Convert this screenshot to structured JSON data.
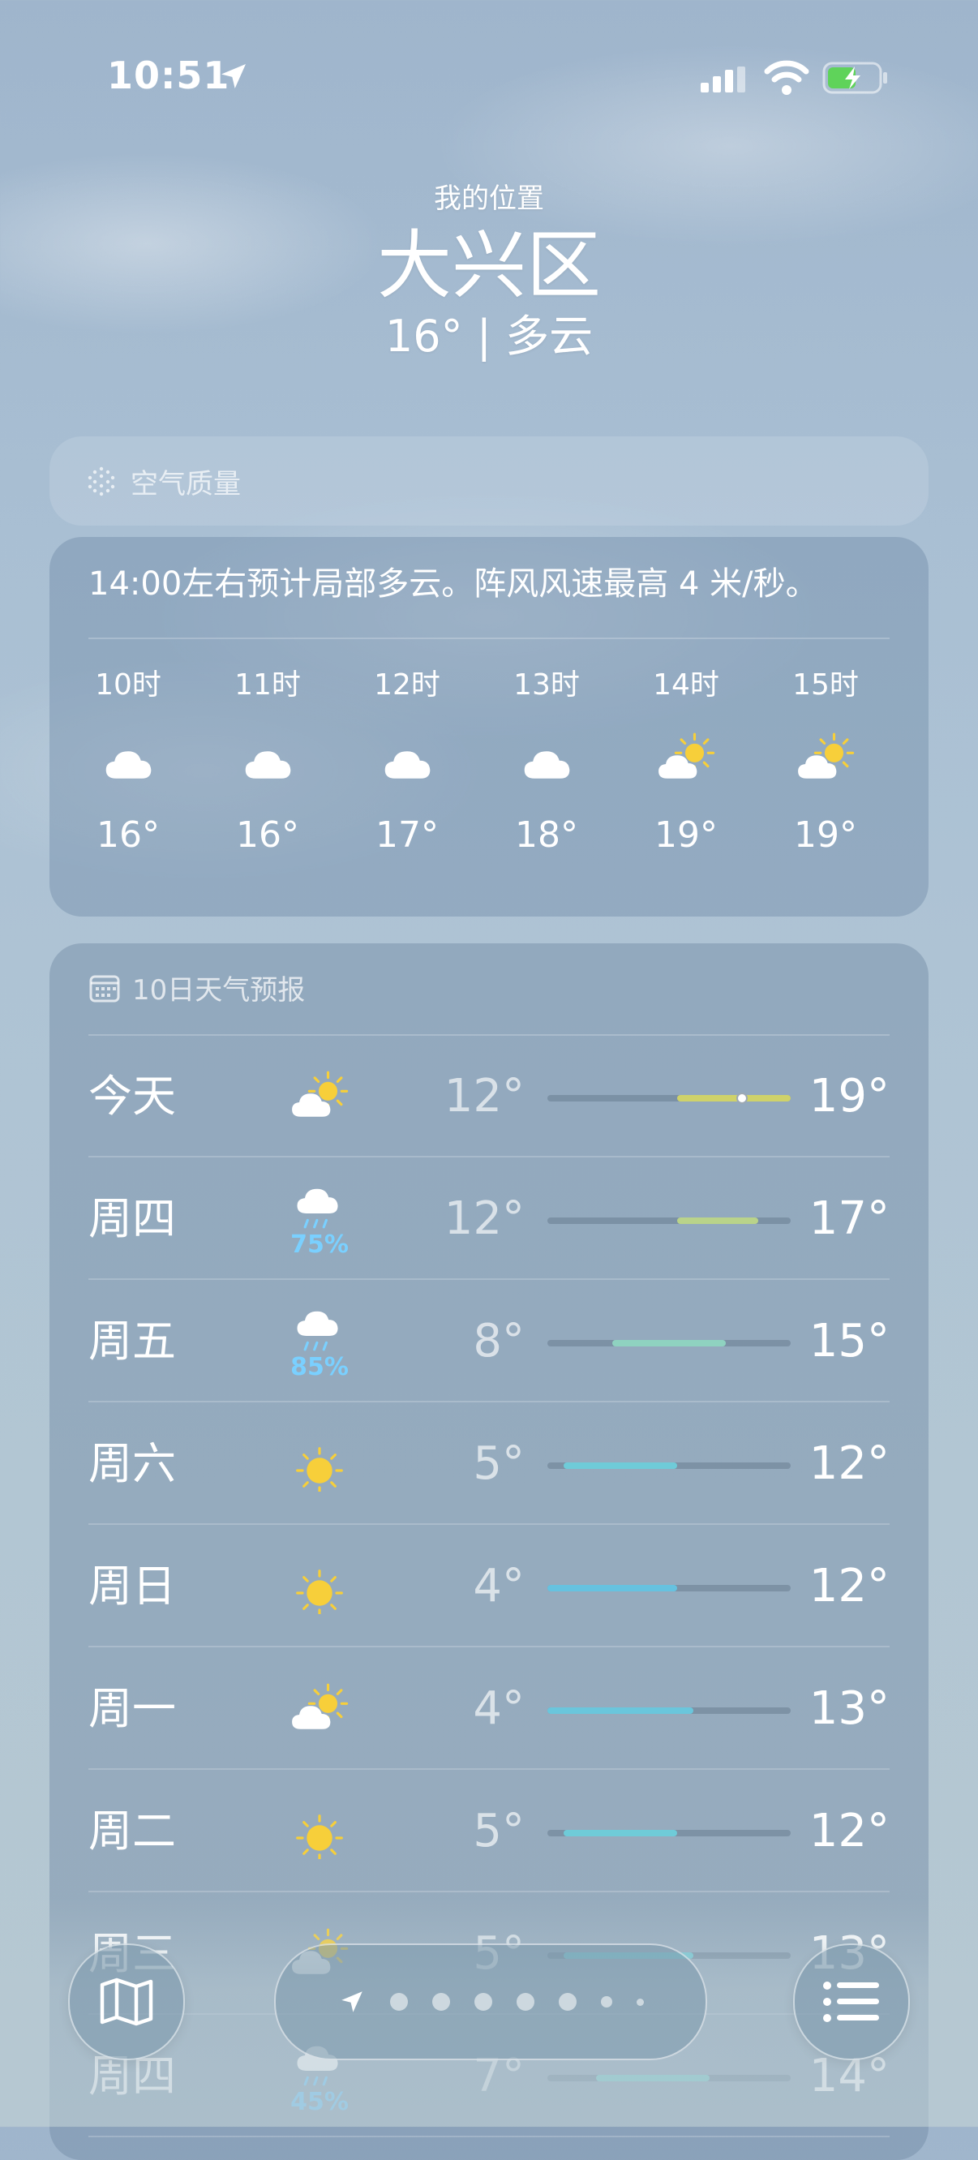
{
  "status_bar": {
    "time": "10:51"
  },
  "header": {
    "location_label": "我的位置",
    "city": "大兴区",
    "condition": "16° | 多云"
  },
  "air_quality": {
    "label": "空气质量",
    "icon": "air-quality-icon"
  },
  "hourly": {
    "description": "14:00左右预计局部多云。阵风风速最高 4 米/秒。",
    "hours": [
      {
        "time": "10时",
        "icon": "cloud",
        "temp": "16°"
      },
      {
        "time": "11时",
        "icon": "cloud",
        "temp": "16°"
      },
      {
        "time": "12时",
        "icon": "cloud",
        "temp": "17°"
      },
      {
        "time": "13时",
        "icon": "cloud",
        "temp": "18°"
      },
      {
        "time": "14时",
        "icon": "partly-cloudy",
        "temp": "19°"
      },
      {
        "time": "15时",
        "icon": "partly-cloudy",
        "temp": "19°"
      }
    ]
  },
  "daily": {
    "title": "10日天气预报",
    "range_min": 4,
    "range_max": 19,
    "days": [
      {
        "name": "今天",
        "icon": "partly-cloudy",
        "pop": "",
        "low": "12°",
        "high": "19°",
        "lo": 12,
        "hi": 19,
        "color": "#cfd26a",
        "current": 16
      },
      {
        "name": "周四",
        "icon": "rain",
        "pop": "75%",
        "low": "12°",
        "high": "17°",
        "lo": 12,
        "hi": 17,
        "color": "#b9d38a"
      },
      {
        "name": "周五",
        "icon": "rain",
        "pop": "85%",
        "low": "8°",
        "high": "15°",
        "lo": 8,
        "hi": 15,
        "color": "#8fd2c0"
      },
      {
        "name": "周六",
        "icon": "sun",
        "pop": "",
        "low": "5°",
        "high": "12°",
        "lo": 5,
        "hi": 12,
        "color": "#6fcbd8"
      },
      {
        "name": "周日",
        "icon": "sun",
        "pop": "",
        "low": "4°",
        "high": "12°",
        "lo": 4,
        "hi": 12,
        "color": "#66c2e0"
      },
      {
        "name": "周一",
        "icon": "partly-cloudy",
        "pop": "",
        "low": "4°",
        "high": "13°",
        "lo": 4,
        "hi": 13,
        "color": "#6ac6dc"
      },
      {
        "name": "周二",
        "icon": "sun",
        "pop": "",
        "low": "5°",
        "high": "12°",
        "lo": 5,
        "hi": 12,
        "color": "#6fcbd8"
      },
      {
        "name": "周三",
        "icon": "partly-cloudy",
        "pop": "",
        "low": "5°",
        "high": "13°",
        "lo": 5,
        "hi": 13,
        "color": "#74cad4"
      },
      {
        "name": "周四",
        "icon": "rain",
        "pop": "45%",
        "low": "7°",
        "high": "14°",
        "lo": 7,
        "hi": 14,
        "color": "#82cfcc"
      }
    ]
  },
  "bottom_bar": {
    "map_icon": "map-icon",
    "list_icon": "list-icon",
    "location_icon": "location-arrow-icon",
    "page_dots": 7
  }
}
